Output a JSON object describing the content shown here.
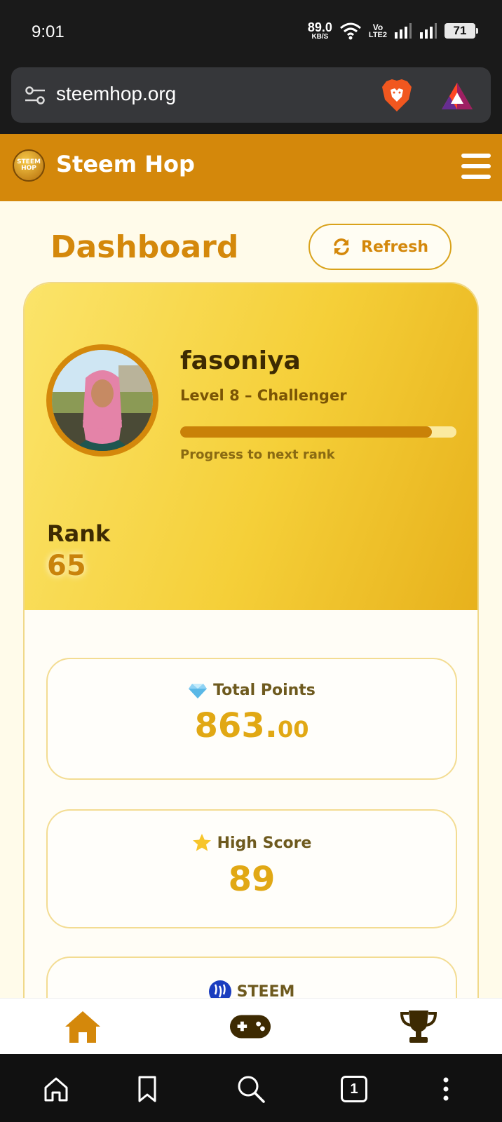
{
  "status_bar": {
    "time": "9:01",
    "net_speed": "89.0",
    "net_unit": "KB/S",
    "volte_top": "Vo",
    "volte_bottom": "LTE2",
    "battery": "71"
  },
  "browser": {
    "url": "steemhop.org"
  },
  "header": {
    "logo_text": "STEEM HOP",
    "title": "Steem Hop"
  },
  "dashboard": {
    "title": "Dashboard",
    "refresh_label": "Refresh"
  },
  "profile": {
    "username": "fasoniya",
    "level": "Level 8 – Challenger",
    "progress_fraction": 0.91,
    "progress_label": "Progress to next rank",
    "rank_label": "Rank",
    "rank_value": "65"
  },
  "stats": {
    "total_points_label": "Total Points",
    "total_points_int": "863.",
    "total_points_dec": "00",
    "high_score_label": "High Score",
    "high_score_value": "89",
    "steem_label": "STEEM"
  },
  "colors": {
    "brand": "#d4880b",
    "card_gold": "#f5cf38",
    "value_gold": "#e1a814",
    "text_dark": "#3d2a02"
  },
  "icons": {
    "nav_home": "home-icon",
    "nav_games": "gamepad-icon",
    "nav_leaderboard": "trophy-icon"
  },
  "android_nav": {
    "tab_count": "1"
  }
}
